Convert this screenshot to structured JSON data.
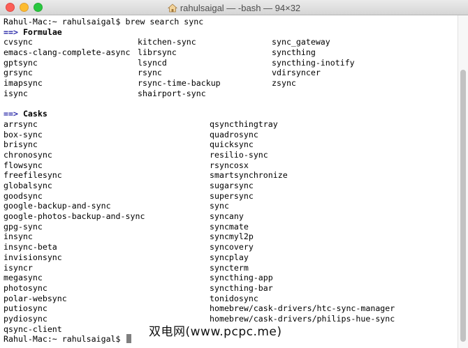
{
  "window": {
    "title": "rahulsaigal — -bash — 94×32",
    "title_icon": "home-folder-icon"
  },
  "terminal": {
    "command_prompt": "Rahul-Mac:~ rahulsaigal$",
    "command": "brew search sync",
    "formulae_header": "Formulae",
    "section_arrow": "==>",
    "formulae": [
      [
        "cvsync",
        "kitchen-sync",
        "sync_gateway"
      ],
      [
        "emacs-clang-complete-async",
        "librsync",
        "syncthing"
      ],
      [
        "gptsync",
        "lsyncd",
        "syncthing-inotify"
      ],
      [
        "grsync",
        "rsync",
        "vdirsyncer"
      ],
      [
        "imapsync",
        "rsync-time-backup",
        "zsync"
      ],
      [
        "isync",
        "shairport-sync",
        ""
      ]
    ],
    "casks_header": "Casks",
    "casks": [
      [
        "arrsync",
        "qsyncthingtray"
      ],
      [
        "box-sync",
        "quadrosync"
      ],
      [
        "brisync",
        "quicksync"
      ],
      [
        "chronosync",
        "resilio-sync"
      ],
      [
        "flowsync",
        "rsyncosx"
      ],
      [
        "freefilesync",
        "smartsynchronize"
      ],
      [
        "globalsync",
        "sugarsync"
      ],
      [
        "goodsync",
        "supersync"
      ],
      [
        "google-backup-and-sync",
        "sync"
      ],
      [
        "google-photos-backup-and-sync",
        "syncany"
      ],
      [
        "gpg-sync",
        "syncmate"
      ],
      [
        "insync",
        "syncmyl2p"
      ],
      [
        "insync-beta",
        "syncovery"
      ],
      [
        "invisionsync",
        "syncplay"
      ],
      [
        "isyncr",
        "syncterm"
      ],
      [
        "megasync",
        "syncthing-app"
      ],
      [
        "photosync",
        "syncthing-bar"
      ],
      [
        "polar-websync",
        "tonidosync"
      ],
      [
        "putiosync",
        "homebrew/cask-drivers/htc-sync-manager"
      ],
      [
        "pydiosync",
        "homebrew/cask-drivers/philips-hue-sync"
      ],
      [
        "qsync-client",
        ""
      ]
    ],
    "final_prompt": "Rahul-Mac:~ rahulsaigal$"
  },
  "watermark": "双电网(www.pcpc.me)",
  "colors": {
    "arrow": "#2a2aa8",
    "close": "#fc5f57",
    "minimize": "#fdbc2e",
    "maximize": "#28c83f"
  }
}
